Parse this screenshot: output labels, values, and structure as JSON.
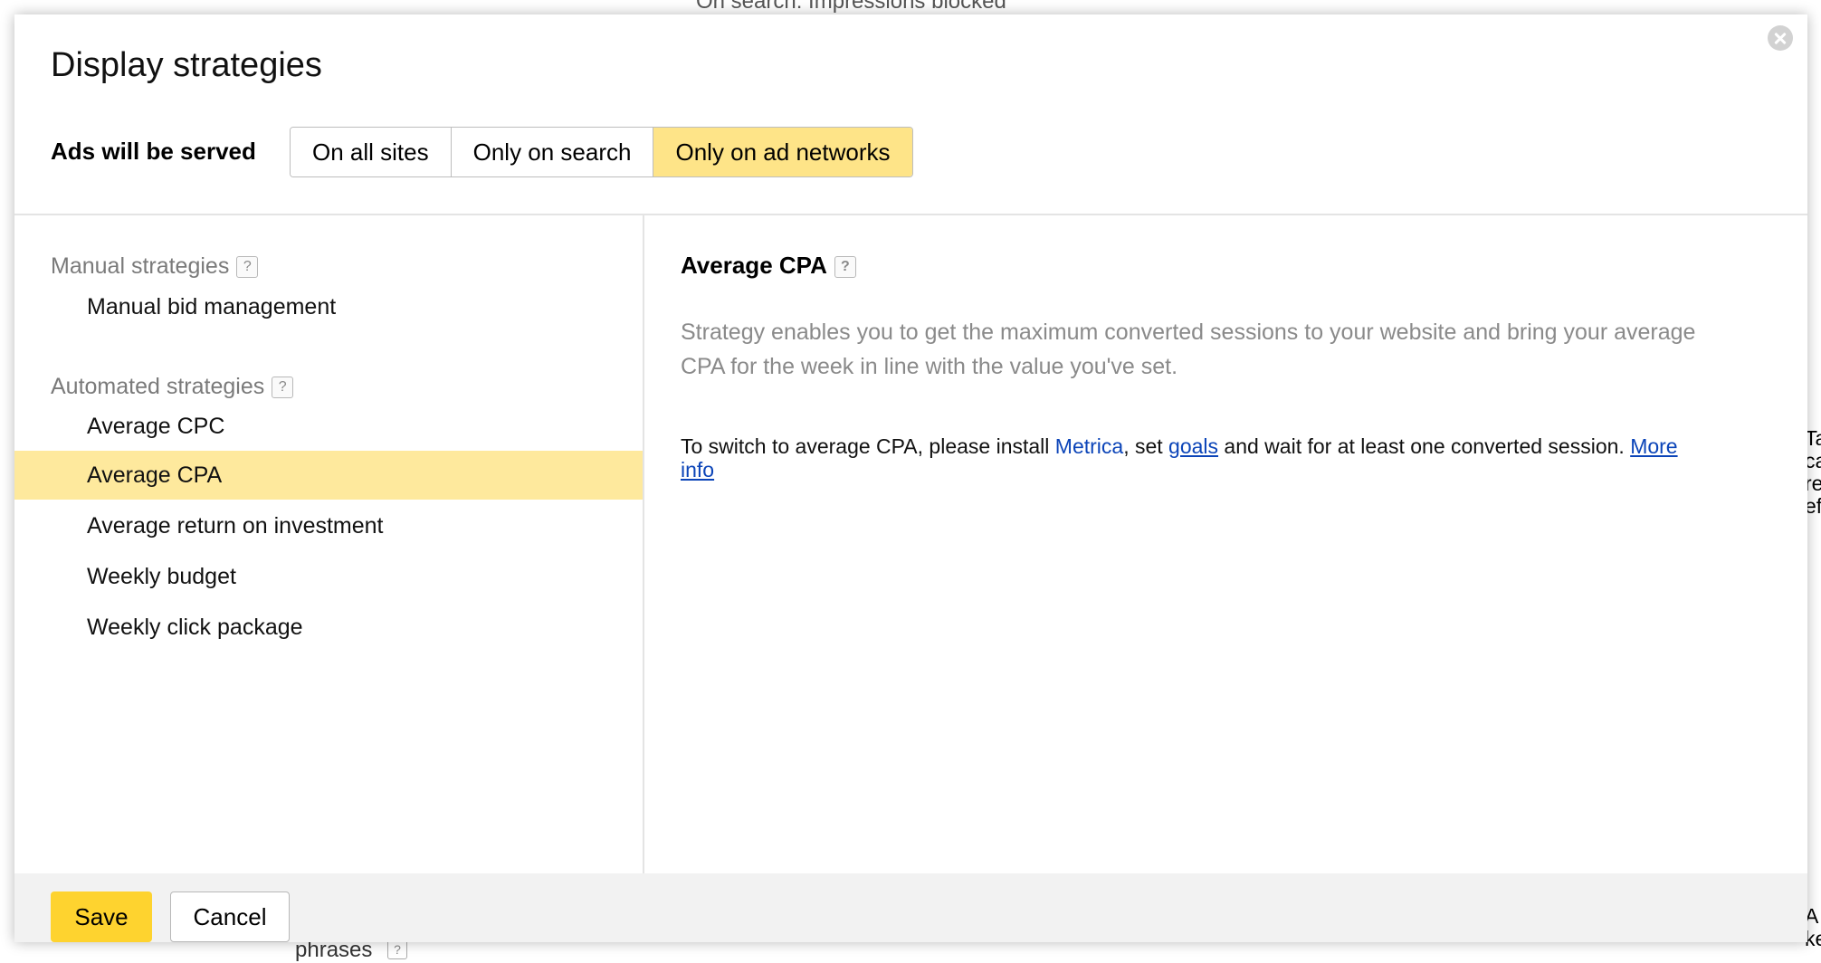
{
  "background": {
    "top_text": "On search: Impressions blocked",
    "bottom_text": "phrases",
    "right_text_lines": [
      "Ta",
      "ca",
      "re",
      "ef"
    ],
    "right_bottom_lines": [
      "A",
      "ke"
    ]
  },
  "dialog": {
    "title": "Display strategies",
    "close_icon": "close-circle-icon",
    "served_label": "Ads will be served",
    "serve_options": [
      "On all sites",
      "Only on search",
      "Only on ad networks"
    ],
    "serve_selected": "Only on ad networks"
  },
  "strategies": {
    "help_glyph": "?",
    "manual_title": "Manual strategies",
    "manual_items": [
      "Manual bid management"
    ],
    "automated_title": "Automated strategies",
    "automated_items": [
      "Average CPC",
      "Average CPA",
      "Average return on investment",
      "Weekly budget",
      "Weekly click package"
    ],
    "selected": "Average CPA"
  },
  "detail": {
    "title": "Average CPA",
    "description": "Strategy enables you to get the maximum converted sessions to your website and bring your average CPA for the week in line with the value you've set.",
    "note_prefix": "To switch to average CPA, please install ",
    "note_metrica": "Metrica",
    "note_mid": ", set ",
    "note_goals": "goals",
    "note_suffix": " and wait for at least one converted session. ",
    "note_more": "More info"
  },
  "footer": {
    "save_label": "Save",
    "cancel_label": "Cancel"
  },
  "colors": {
    "selected_bg": "#fee99d",
    "save_bg": "#fed32f",
    "link": "#0b44b8"
  }
}
